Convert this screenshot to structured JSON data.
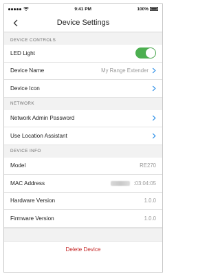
{
  "status": {
    "time": "9:41 PM",
    "battery": "100%"
  },
  "nav": {
    "title": "Device Settings"
  },
  "sections": {
    "controls": {
      "header": "DEVICE CONTROLS",
      "led_label": "LED Light",
      "led_on": true,
      "name_label": "Device Name",
      "name_value": "My Range Extender",
      "icon_label": "Device Icon"
    },
    "network": {
      "header": "NETWORK",
      "admin_label": "Network Admin Password",
      "location_label": "Use Location Assistant"
    },
    "info": {
      "header": "DEVICE INFO",
      "model_label": "Model",
      "model_value": "RE270",
      "mac_label": "MAC Address",
      "mac_value": ":03:04:05",
      "hw_label": "Hardware Version",
      "hw_value": "1.0.0",
      "fw_label": "Firmware Version",
      "fw_value": "1.0.0"
    }
  },
  "actions": {
    "delete_label": "Delete Device"
  },
  "colors": {
    "toggle_on": "#4caf50",
    "chevron": "#2a8ee8",
    "delete": "#c62828"
  }
}
